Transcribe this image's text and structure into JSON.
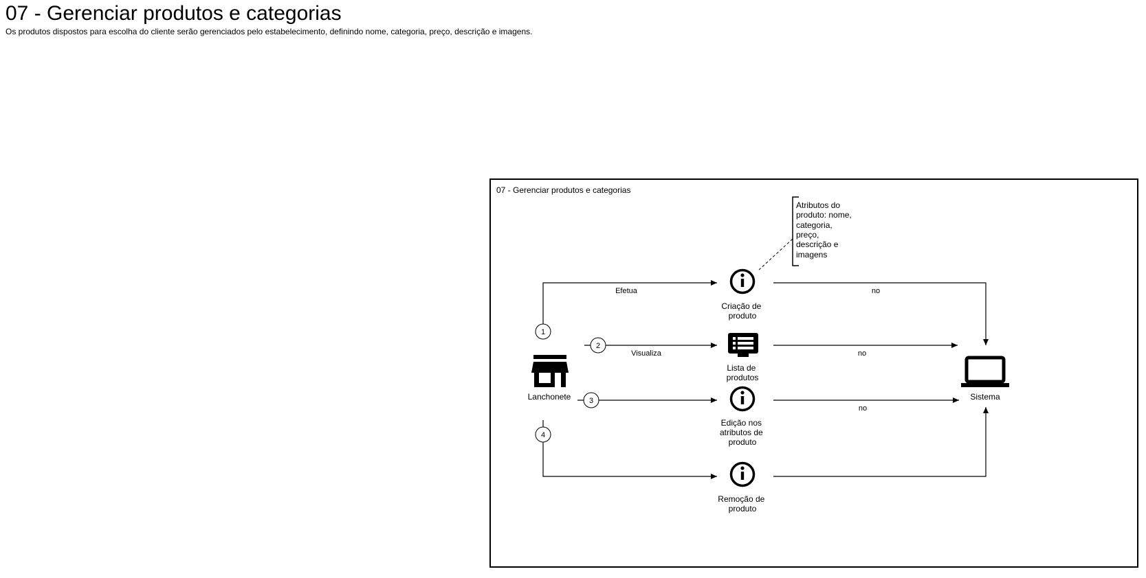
{
  "header": {
    "title": "07 - Gerenciar produtos e categorias",
    "subtitle": "Os produtos dispostos para escolha do cliente serão gerenciados pelo estabelecimento, definindo nome, categoria, preço, descrição e imagens."
  },
  "diagram": {
    "frame_title": "07 - Gerenciar produtos e categorias",
    "annotation": [
      "Atributos do",
      "produto: nome,",
      "categoria,",
      "preço,",
      "descrição e",
      "imagens"
    ],
    "actor": {
      "label": "Lanchonete",
      "icon": "store-icon"
    },
    "system": {
      "label": "Sistema",
      "icon": "laptop-icon"
    },
    "nodes": {
      "create": {
        "lines": [
          "Criação de",
          "produto"
        ],
        "icon": "info-icon"
      },
      "list": {
        "lines": [
          "Lista de",
          "produtos"
        ],
        "icon": "list-display-icon"
      },
      "edit": {
        "lines": [
          "Edição nos",
          "atributos de",
          "produto"
        ],
        "icon": "info-icon"
      },
      "remove": {
        "lines": [
          "Remoção de",
          "produto"
        ],
        "icon": "info-icon"
      }
    },
    "steps": [
      "1",
      "2",
      "3",
      "4"
    ],
    "flow_labels": {
      "create_in": "Efetua",
      "list_in": "Visualiza",
      "create_out": "no",
      "list_out": "no",
      "edit_out": "no"
    }
  }
}
